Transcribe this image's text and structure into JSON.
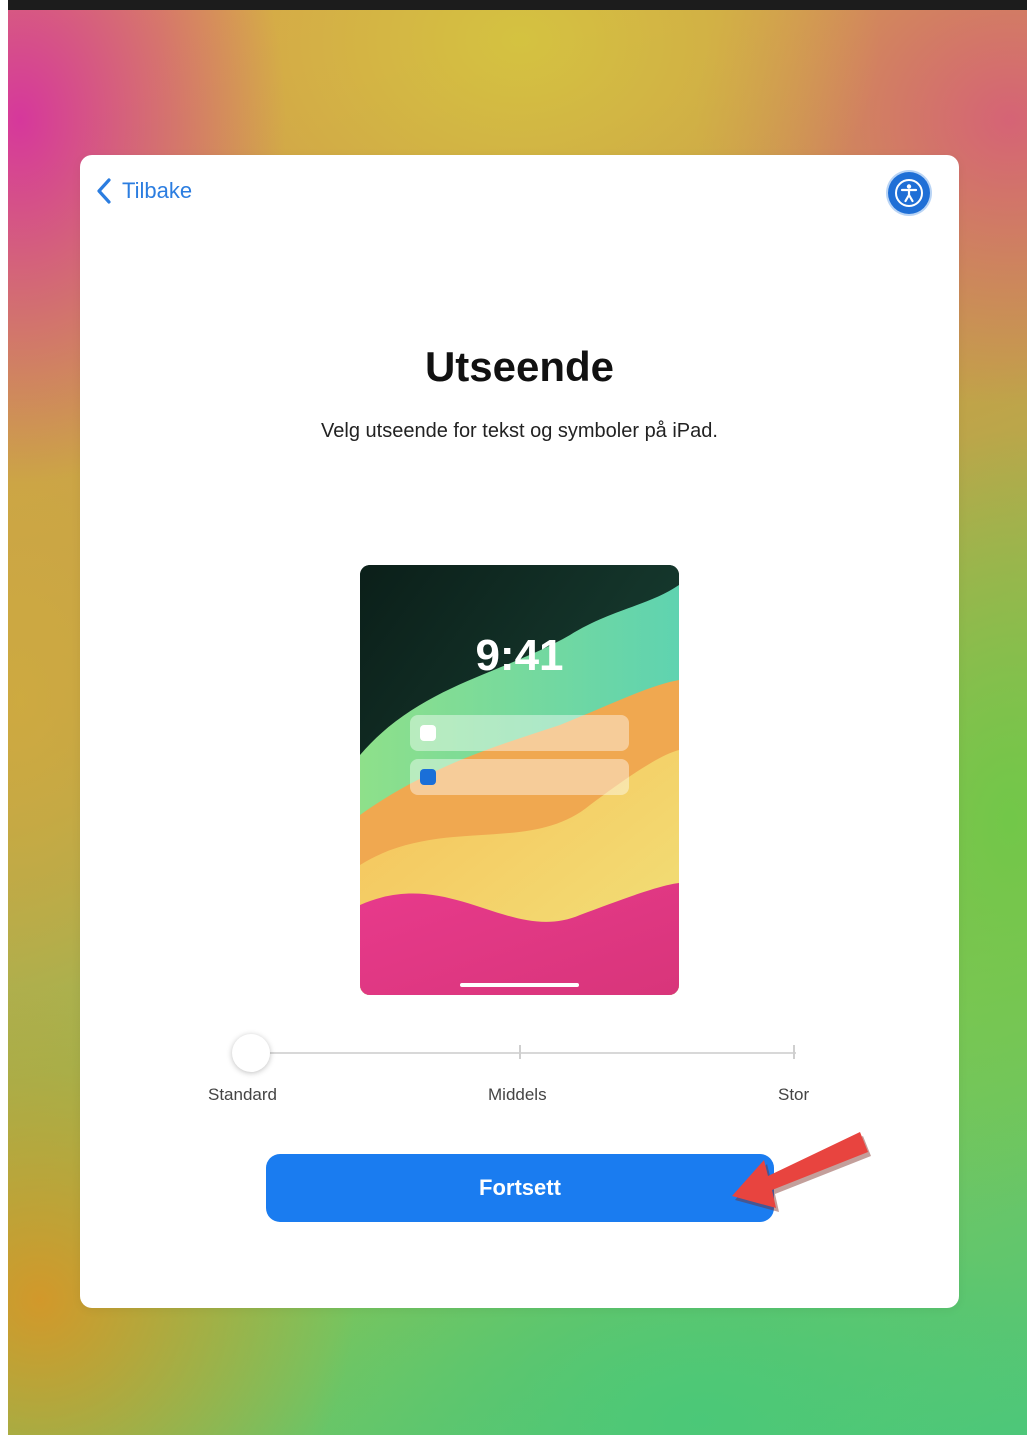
{
  "nav": {
    "back_label": "Tilbake"
  },
  "icons": {
    "back": "chevron-left-icon",
    "accessibility": "accessibility-icon"
  },
  "page": {
    "title": "Utseende",
    "subtitle": "Velg utseende for tekst og symboler på iPad."
  },
  "preview": {
    "time": "9:41"
  },
  "text_size_slider": {
    "options": [
      "Standard",
      "Middels",
      "Stor"
    ],
    "selected": "Standard"
  },
  "actions": {
    "continue_label": "Fortsett"
  },
  "colors": {
    "accent": "#1a7cf0",
    "back_link": "#2b7de0",
    "annotation_arrow": "#e8443f"
  }
}
